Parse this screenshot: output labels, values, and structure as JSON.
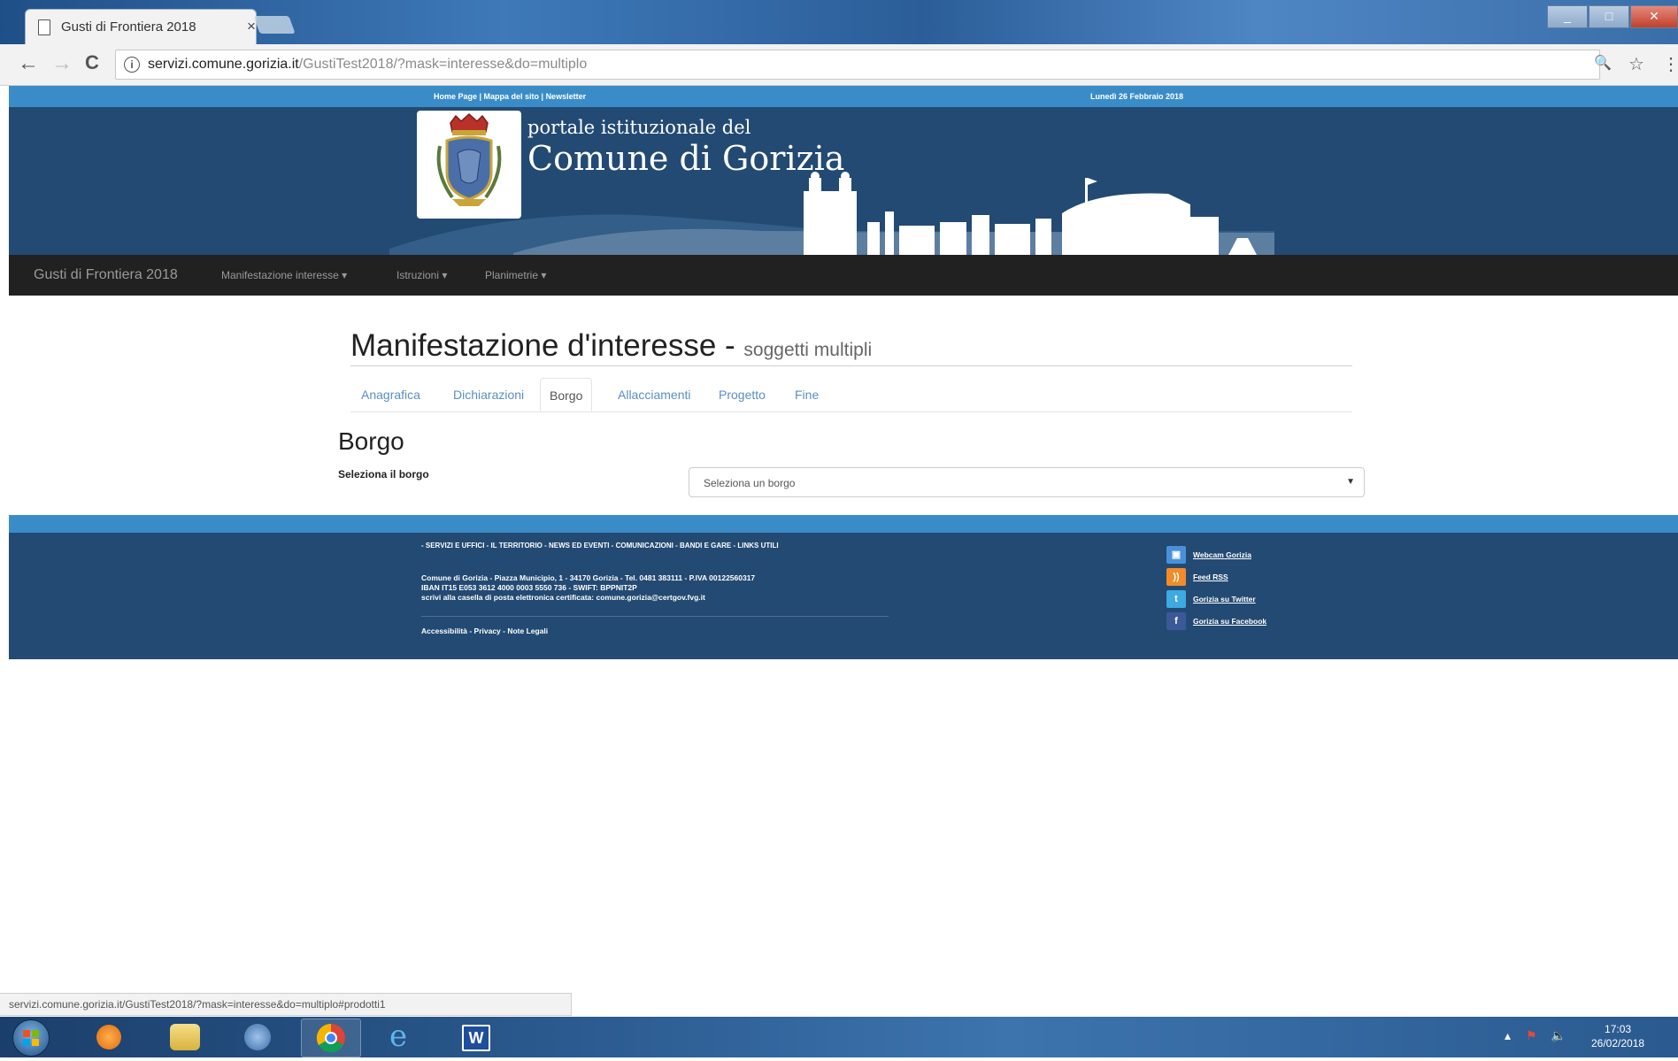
{
  "browser": {
    "tab_title": "Gusti di Frontiera 2018",
    "tab_close": "×",
    "url_host": "servizi.comune.gorizia.it",
    "url_path": "/GustiTest2018/?mask=interesse&do=multiplo",
    "nav_back": "←",
    "nav_forward": "→",
    "nav_reload": "C",
    "zoom_icon": "🔍",
    "star_icon": "☆",
    "menu_icon": "⋮"
  },
  "site": {
    "top_links": "Home Page  |  Mappa del sito  |  Newsletter",
    "date": "Lunedì 26 Febbraio 2018",
    "portal_sub": "portale istituzionale del",
    "portal_title": "Comune di Gorizia"
  },
  "nav": {
    "brand": "Gusti di Frontiera 2018",
    "items": [
      "Manifestazione interesse ▾",
      "Istruzioni ▾",
      "Planimetrie ▾"
    ]
  },
  "main": {
    "title": "Manifestazione d'interesse",
    "title_sep": " - ",
    "subtitle": "soggetti multipli",
    "tabs": [
      "Anagrafica",
      "Dichiarazioni",
      "Borgo",
      "Allacciamenti",
      "Progetto",
      "Fine"
    ],
    "active_tab": "Borgo",
    "section_heading": "Borgo",
    "field_label": "Seleziona il borgo",
    "select_value": "Seleziona un borgo",
    "select_arrow": "▼"
  },
  "footer": {
    "links": "- SERVIZI E UFFICI  - IL TERRITORIO  - NEWS ED EVENTI  - COMUNICAZIONI  - BANDI E GARE  - LINKS UTILI",
    "address_lines": [
      "Comune di Gorizia - Piazza Municipio, 1 - 34170 Gorizia - Tel. 0481 383111 - P.IVA 00122560317",
      "IBAN IT15 E053 3612 4000 0003 5550 736 - SWIFT: BPPNIT2P",
      "scrivi alla casella di posta elettronica certificata: comune.gorizia@certgov.fvg.it"
    ],
    "legal": "Accessibilità  - Privacy  - Note Legali",
    "social": [
      {
        "label": "Webcam Gorizia",
        "icon": "webcam-icon",
        "color": "#4a90d9"
      },
      {
        "label": "Feed RSS",
        "icon": "rss-icon",
        "color": "#f28c28"
      },
      {
        "label": "Gorizia su Twitter",
        "icon": "twitter-icon",
        "color": "#3fa9e1"
      },
      {
        "label": "Gorizia su Facebook",
        "icon": "facebook-icon",
        "color": "#3b5998"
      }
    ]
  },
  "statusbar": {
    "text": "servizi.comune.gorizia.it/GustiTest2018/?mask=interesse&do=multiplo#prodotti1"
  },
  "taskbar": {
    "time": "17:03",
    "date": "26/02/2018"
  },
  "colors": {
    "accent_blue": "#3a8cc8",
    "header_navy": "#234a73",
    "nav_dark": "#212121",
    "link_blue": "#5a8fc4"
  }
}
